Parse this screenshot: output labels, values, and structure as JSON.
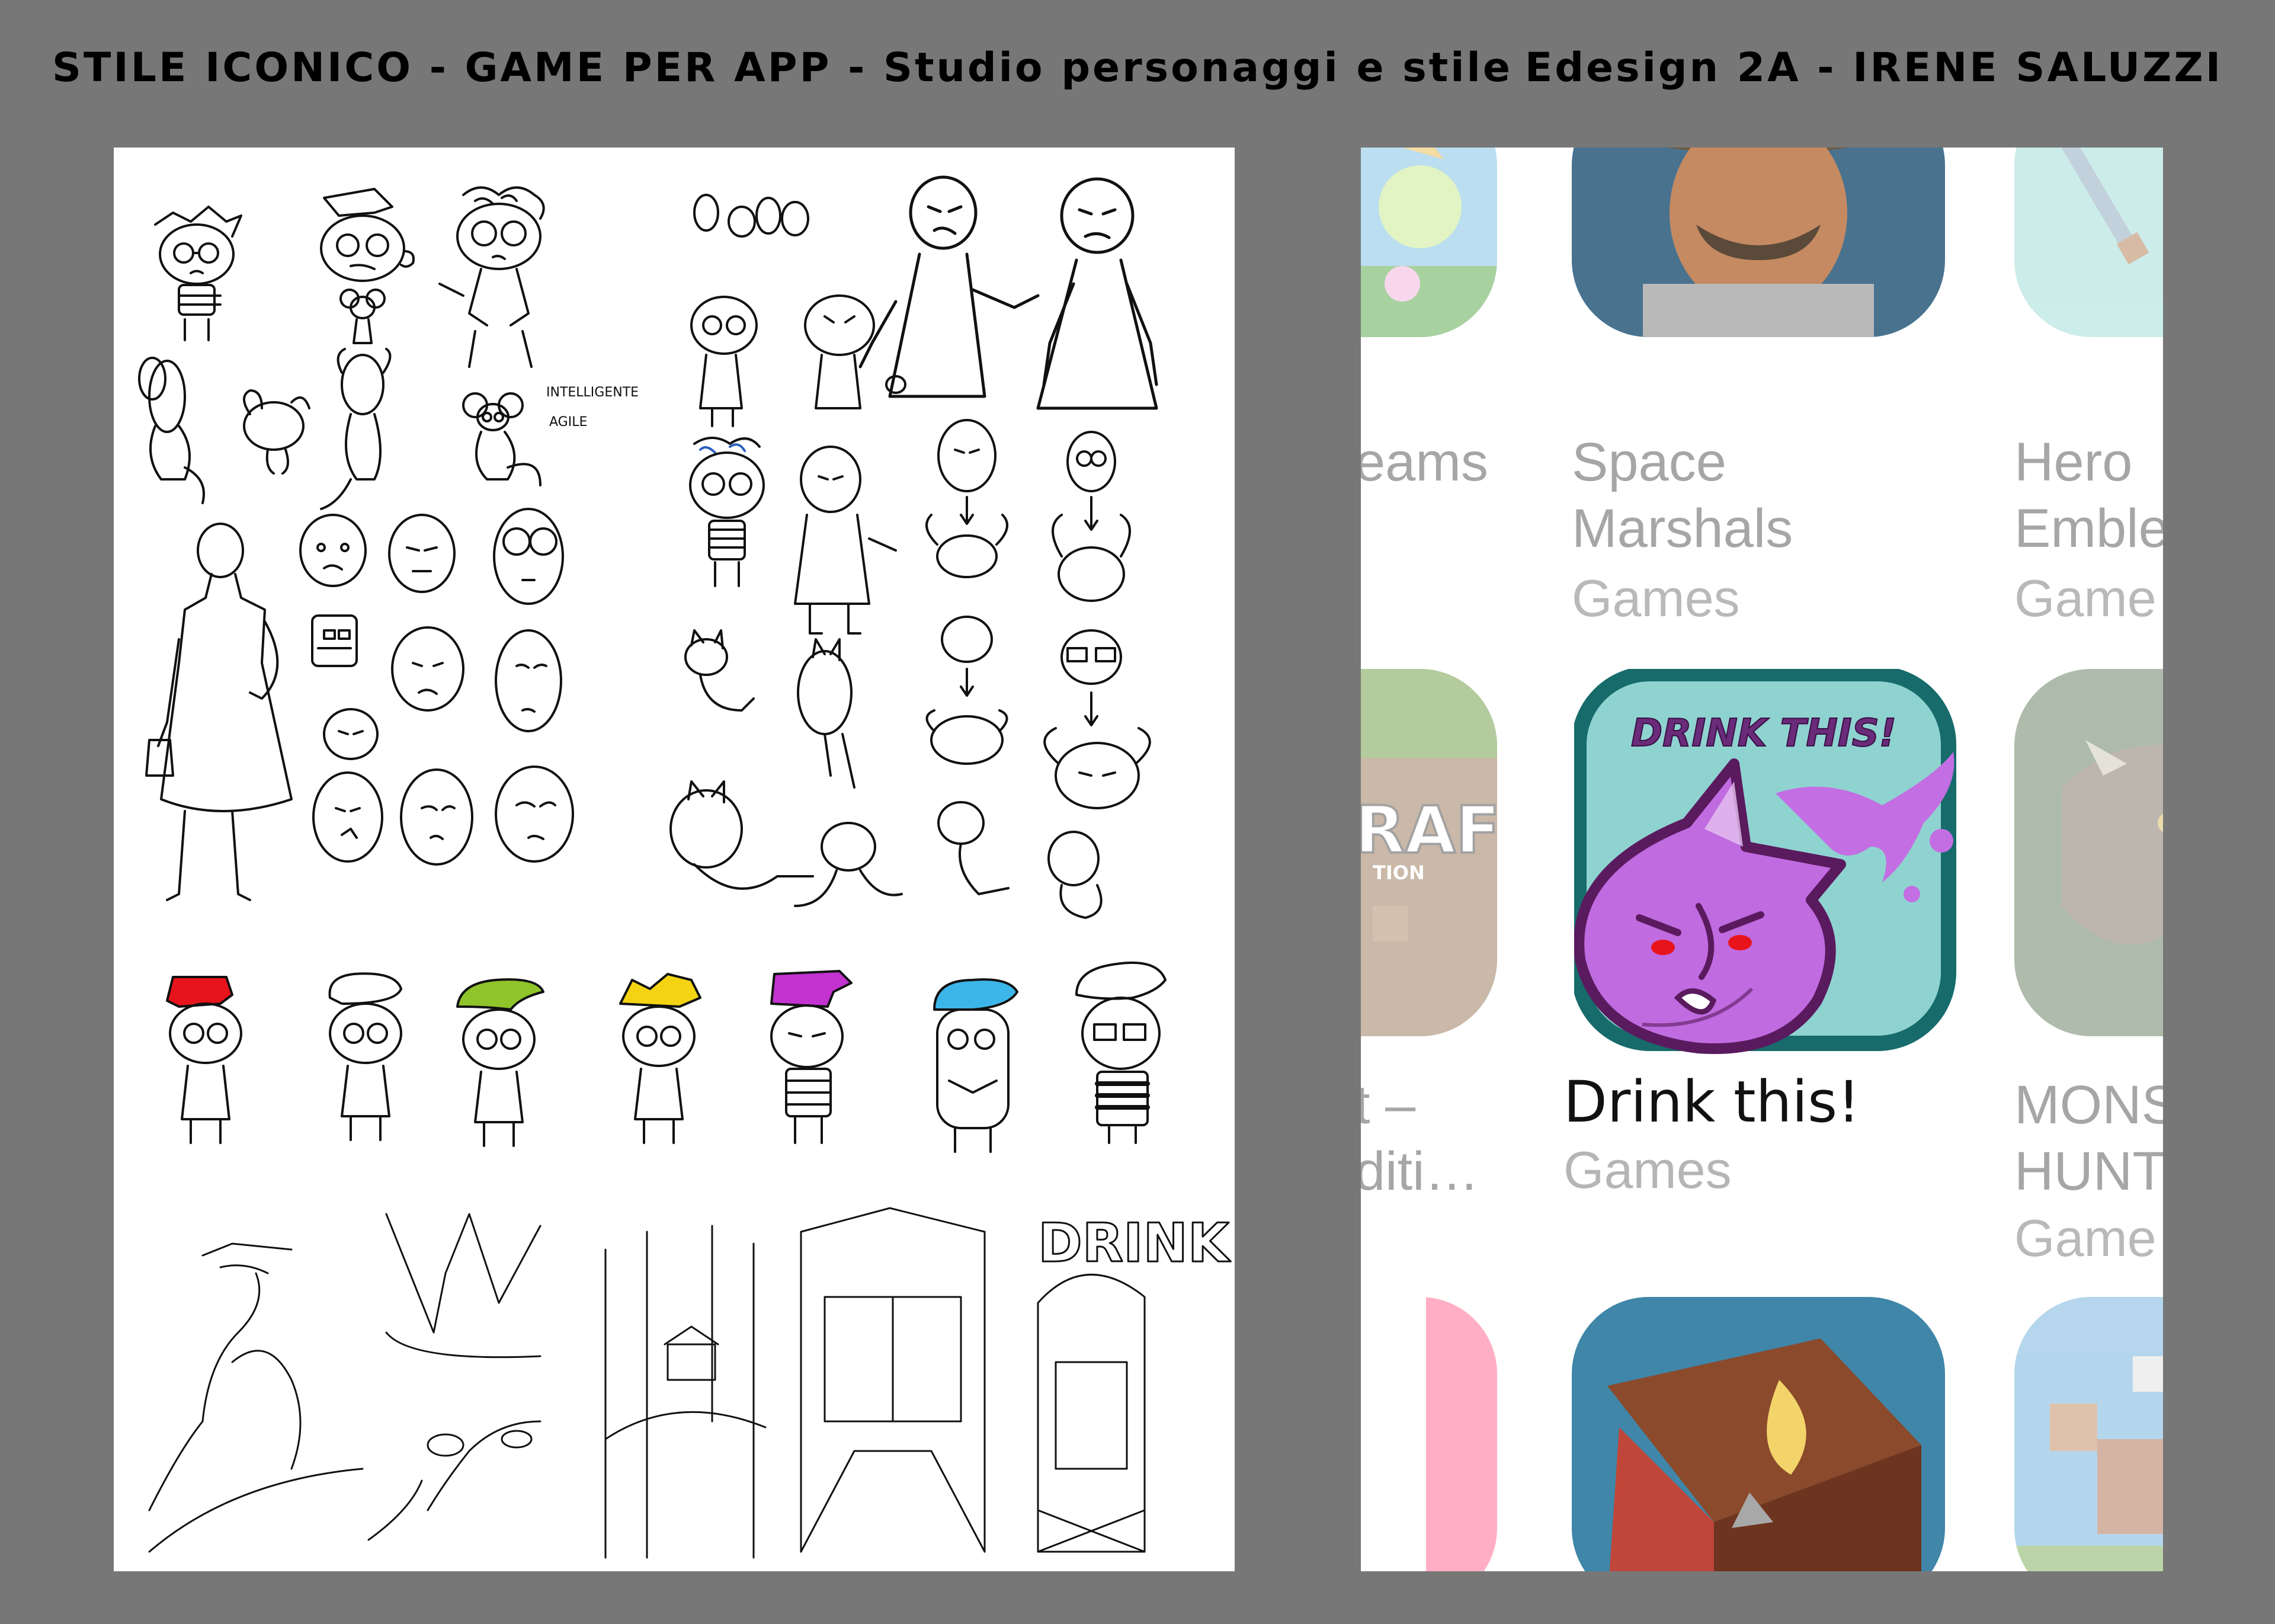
{
  "header": {
    "left_title": "STILE ICONICO - GAME PER APP - Studio personaggi e stile",
    "right_title": "Edesign 2A - IRENE SALUZZI"
  },
  "sketch_sheet": {
    "notes": [
      "INTELLIGENTE",
      "AGILE"
    ],
    "lettering": "DRINK",
    "hair_colors": [
      "#e8141c",
      "#ffffff",
      "#8fc42a",
      "#f4d313",
      "#c233d0",
      "#3cb6e8",
      "#ffffff"
    ]
  },
  "app_store": {
    "apps": [
      {
        "name_lines": [
          "eams"
        ],
        "category": "",
        "icon": "flower-game-icon"
      },
      {
        "name_lines": [
          "Space",
          "Marshals"
        ],
        "category": "Games",
        "icon": "cowboy-icon"
      },
      {
        "name_lines": [
          "Hero",
          "Emble"
        ],
        "category": "Game",
        "icon": "sword-icon"
      },
      {
        "name_lines": [
          "t –",
          "diti…"
        ],
        "category": "",
        "icon": "craft-block-icon"
      },
      {
        "name_lines": [
          "Drink this!"
        ],
        "category": "Games",
        "icon": "drink-this-icon"
      },
      {
        "name_lines": [
          "MONS",
          "HUNT"
        ],
        "category": "Game",
        "icon": "monster-icon"
      }
    ],
    "featured_icon_text": "DRINK THIS!",
    "craft_text": "RAFT",
    "craft_sub": "TION"
  },
  "colors": {
    "background": "#777777",
    "icon_teal": "#8fd3d1",
    "icon_border": "#176b6b",
    "potion_purple": "#c06be0",
    "potion_outline": "#5a1a5e"
  }
}
